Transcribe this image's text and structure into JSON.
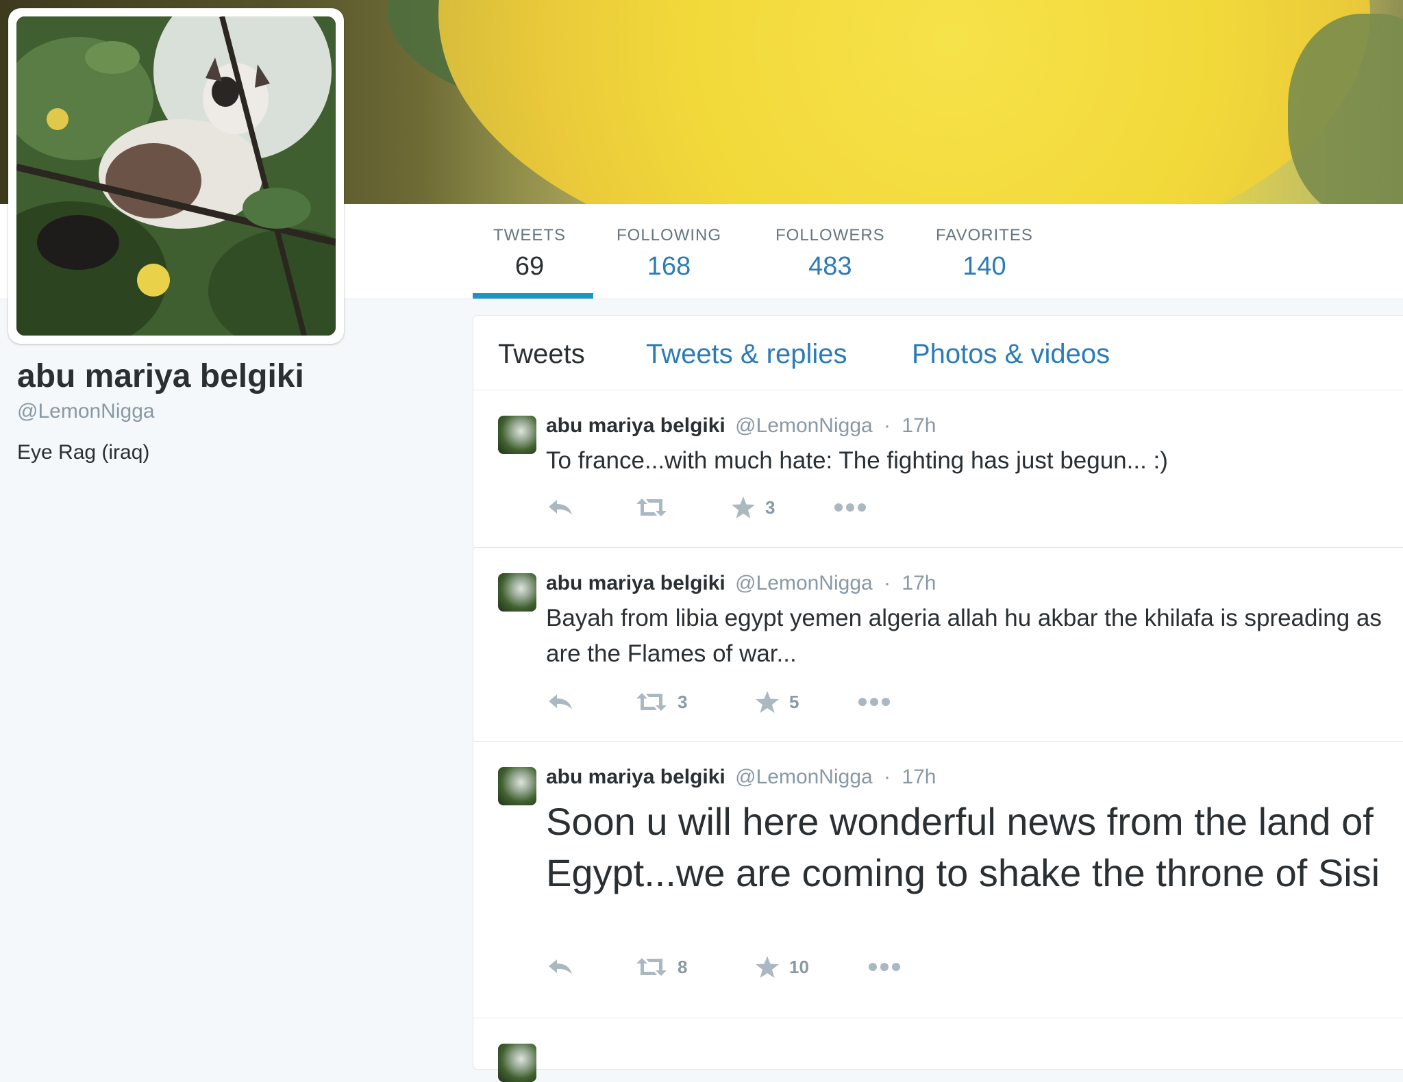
{
  "profile": {
    "name": "abu mariya belgiki",
    "handle": "@LemonNigga",
    "bio": "Eye Rag (iraq)"
  },
  "stats": [
    {
      "label": "TWEETS",
      "value": "69"
    },
    {
      "label": "FOLLOWING",
      "value": "168"
    },
    {
      "label": "FOLLOWERS",
      "value": "483"
    },
    {
      "label": "FAVORITES",
      "value": "140"
    }
  ],
  "tabs": [
    "Tweets",
    "Tweets & replies",
    "Photos & videos"
  ],
  "tweets": [
    {
      "name": "abu mariya belgiki",
      "handle": "@LemonNigga",
      "separator": "·",
      "time": "17h",
      "text": "To france...with much hate: The fighting has just begun... :)",
      "retweets": "",
      "favorites": "3"
    },
    {
      "name": "abu mariya belgiki",
      "handle": "@LemonNigga",
      "separator": "·",
      "time": "17h",
      "text": "Bayah from libia egypt yemen algeria allah hu akbar the khilafa is spreading as are the Flames of war...",
      "retweets": "3",
      "favorites": "5"
    },
    {
      "name": "abu mariya belgiki",
      "handle": "@LemonNigga",
      "separator": "·",
      "time": "17h",
      "text": "Soon u will here wonderful news from the land of Egypt...we are coming to shake the throne of Sisi",
      "retweets": "8",
      "favorites": "10"
    }
  ],
  "icons": {
    "reply": "reply-icon",
    "retweet": "retweet-icon",
    "favorite": "star-icon",
    "more": "more-icon"
  },
  "colors": {
    "link": "#2b7bb9",
    "active_underline": "#1c94c6",
    "muted": "#8899a6"
  }
}
